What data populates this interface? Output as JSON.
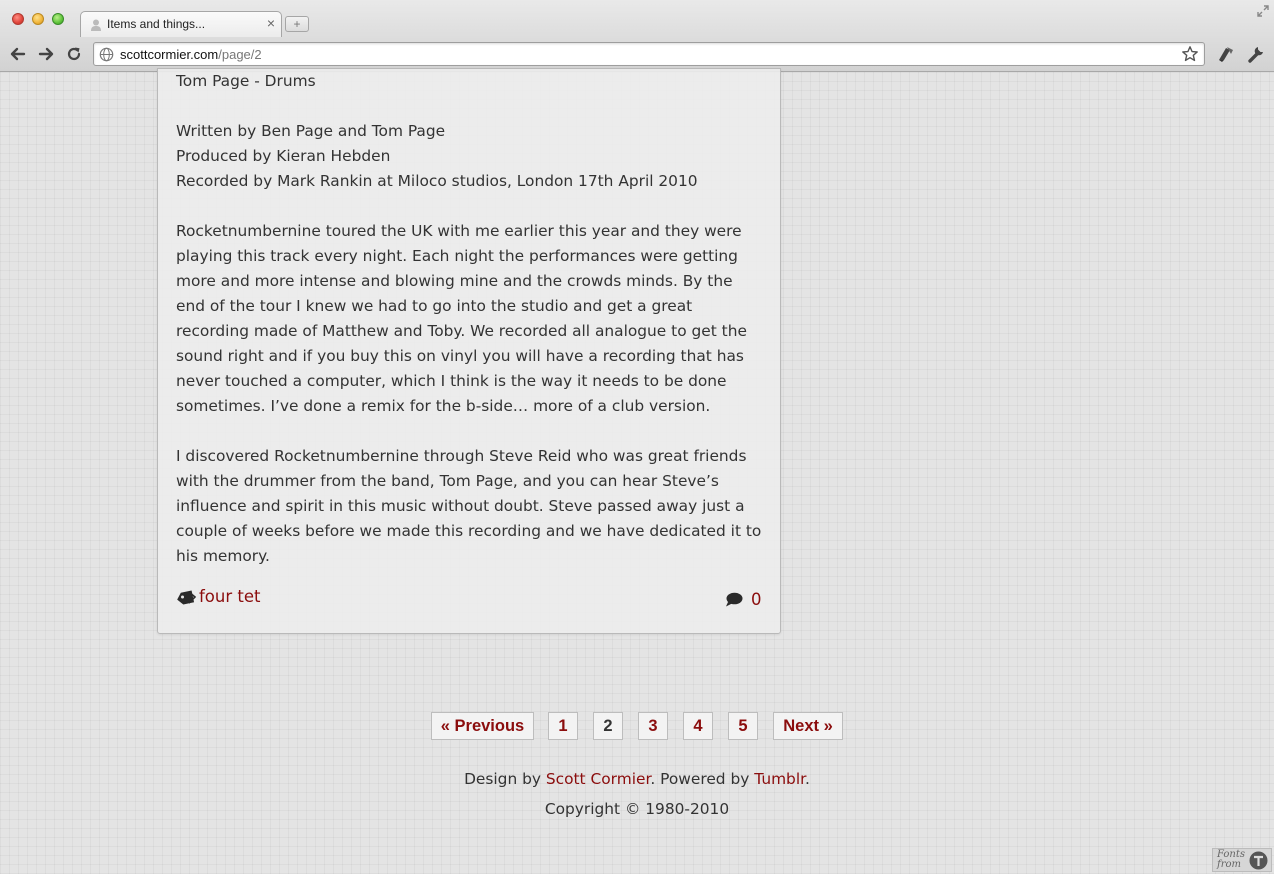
{
  "browser": {
    "tab_title": "Items and things...",
    "tab_close": "×",
    "new_tab": "+",
    "url_domain": "scottcormier.com",
    "url_path": "/page/2"
  },
  "post": {
    "paragraphs": [
      "Tom Page - Drums",
      "Written by Ben Page and Tom Page\nProduced by Kieran Hebden\nRecorded by Mark Rankin at Miloco studios, London 17th April 2010",
      "Rocketnumbernine toured the UK with me earlier this year and they were playing this track every night. Each night the performances were getting more and more intense and blowing mine and the crowds minds. By the end of the tour I knew we had to go into the studio and get a great recording made of Matthew and Toby. We recorded all analogue to get the sound right and if you buy this on vinyl you will have a recording that has never touched a computer, which I think is the way it needs to be done sometimes. I’ve done a remix for the b-side… more of a club version.",
      "I discovered Rocketnumbernine through Steve Reid who was great friends with the drummer from the band, Tom Page, and you can hear Steve’s influence and spirit in this music without doubt. Steve passed away just a couple of weeks before we made this recording and we have dedicated it to his memory."
    ],
    "tag": "four tet",
    "comment_count": "0"
  },
  "pagination": {
    "previous": "« Previous",
    "pages": [
      "1",
      "2",
      "3",
      "4",
      "5"
    ],
    "current_page": "2",
    "next": "Next »"
  },
  "footer": {
    "design_prefix": "Design by ",
    "designer": "Scott Cormier",
    "powered_prefix": ". Powered by ",
    "platform": "Tumblr",
    "suffix": ".",
    "copyright": "Copyright © 1980-2010"
  },
  "fonts_badge": {
    "text": "Fonts from"
  },
  "colors": {
    "link": "#8b0d0d",
    "text": "#333333",
    "background": "#e4e4e4"
  },
  "icons": [
    "back-arrow-icon",
    "forward-arrow-icon",
    "reload-icon",
    "globe-icon",
    "star-icon",
    "tag-icon",
    "comment-icon",
    "wrench-icon",
    "extension-icon",
    "typekit-logo"
  ]
}
